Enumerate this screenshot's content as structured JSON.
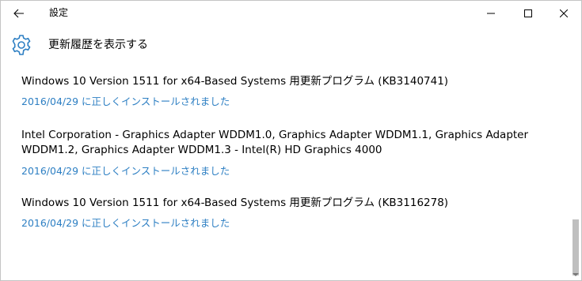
{
  "window": {
    "title": "設定"
  },
  "header": {
    "title": "更新履歴を表示する"
  },
  "updates": [
    {
      "title": "Windows 10 Version 1511 for x64-Based Systems 用更新プログラム (KB3140741)",
      "status": "2016/04/29 に正しくインストールされました"
    },
    {
      "title": "Intel Corporation - Graphics Adapter WDDM1.0, Graphics Adapter WDDM1.1, Graphics Adapter WDDM1.2, Graphics Adapter WDDM1.3 - Intel(R) HD Graphics 4000",
      "status": "2016/04/29 に正しくインストールされました"
    },
    {
      "title": "Windows 10 Version 1511 for x64-Based Systems 用更新プログラム (KB3116278)",
      "status": "2016/04/29 に正しくインストールされました"
    }
  ],
  "icons": {
    "back": "back-arrow-icon",
    "settings": "gear-icon",
    "minimize": "minimize-icon",
    "maximize": "maximize-icon",
    "close": "close-icon"
  },
  "colors": {
    "link": "#2d7fc3",
    "gear_icon": "#2d7fc3",
    "text": "#000000"
  }
}
